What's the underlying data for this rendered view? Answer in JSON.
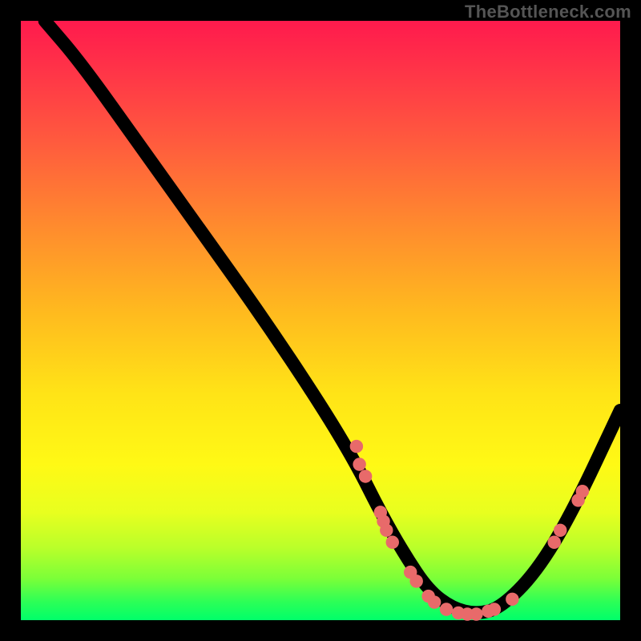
{
  "watermark": "TheBottleneck.com",
  "chart_data": {
    "type": "line",
    "title": "",
    "xlabel": "",
    "ylabel": "",
    "xlim": [
      0,
      100
    ],
    "ylim": [
      0,
      100
    ],
    "grid": false,
    "legend": false,
    "background": "heatmap-gradient",
    "gradient_stops": [
      {
        "pos": 0,
        "color": "#ff1a4d"
      },
      {
        "pos": 20,
        "color": "#ff5a3e"
      },
      {
        "pos": 48,
        "color": "#ffb81f"
      },
      {
        "pos": 74,
        "color": "#fff915"
      },
      {
        "pos": 93,
        "color": "#7cff38"
      },
      {
        "pos": 100,
        "color": "#00ff6a"
      }
    ],
    "series": [
      {
        "name": "bottleneck-curve",
        "x": [
          4,
          10,
          20,
          30,
          40,
          50,
          56,
          60,
          64,
          68,
          72,
          76,
          80,
          86,
          92,
          100
        ],
        "y": [
          100,
          93,
          79,
          65,
          51,
          36,
          26,
          18,
          11,
          5,
          2,
          1,
          2,
          8,
          18,
          35
        ]
      }
    ],
    "markers": {
      "name": "highlighted-points",
      "color": "#e86a6a",
      "points": [
        {
          "x": 56,
          "y": 29
        },
        {
          "x": 56.5,
          "y": 26
        },
        {
          "x": 57.5,
          "y": 24
        },
        {
          "x": 60,
          "y": 18
        },
        {
          "x": 60.5,
          "y": 16.5
        },
        {
          "x": 61,
          "y": 15
        },
        {
          "x": 62,
          "y": 13
        },
        {
          "x": 65,
          "y": 8
        },
        {
          "x": 66,
          "y": 6.5
        },
        {
          "x": 68,
          "y": 4
        },
        {
          "x": 69,
          "y": 3
        },
        {
          "x": 71,
          "y": 1.8
        },
        {
          "x": 73,
          "y": 1.2
        },
        {
          "x": 74.5,
          "y": 1
        },
        {
          "x": 76,
          "y": 1
        },
        {
          "x": 78,
          "y": 1.5
        },
        {
          "x": 79,
          "y": 1.8
        },
        {
          "x": 82,
          "y": 3.5
        },
        {
          "x": 89,
          "y": 13
        },
        {
          "x": 90,
          "y": 15
        },
        {
          "x": 93,
          "y": 20
        },
        {
          "x": 93.7,
          "y": 21.5
        }
      ]
    }
  }
}
